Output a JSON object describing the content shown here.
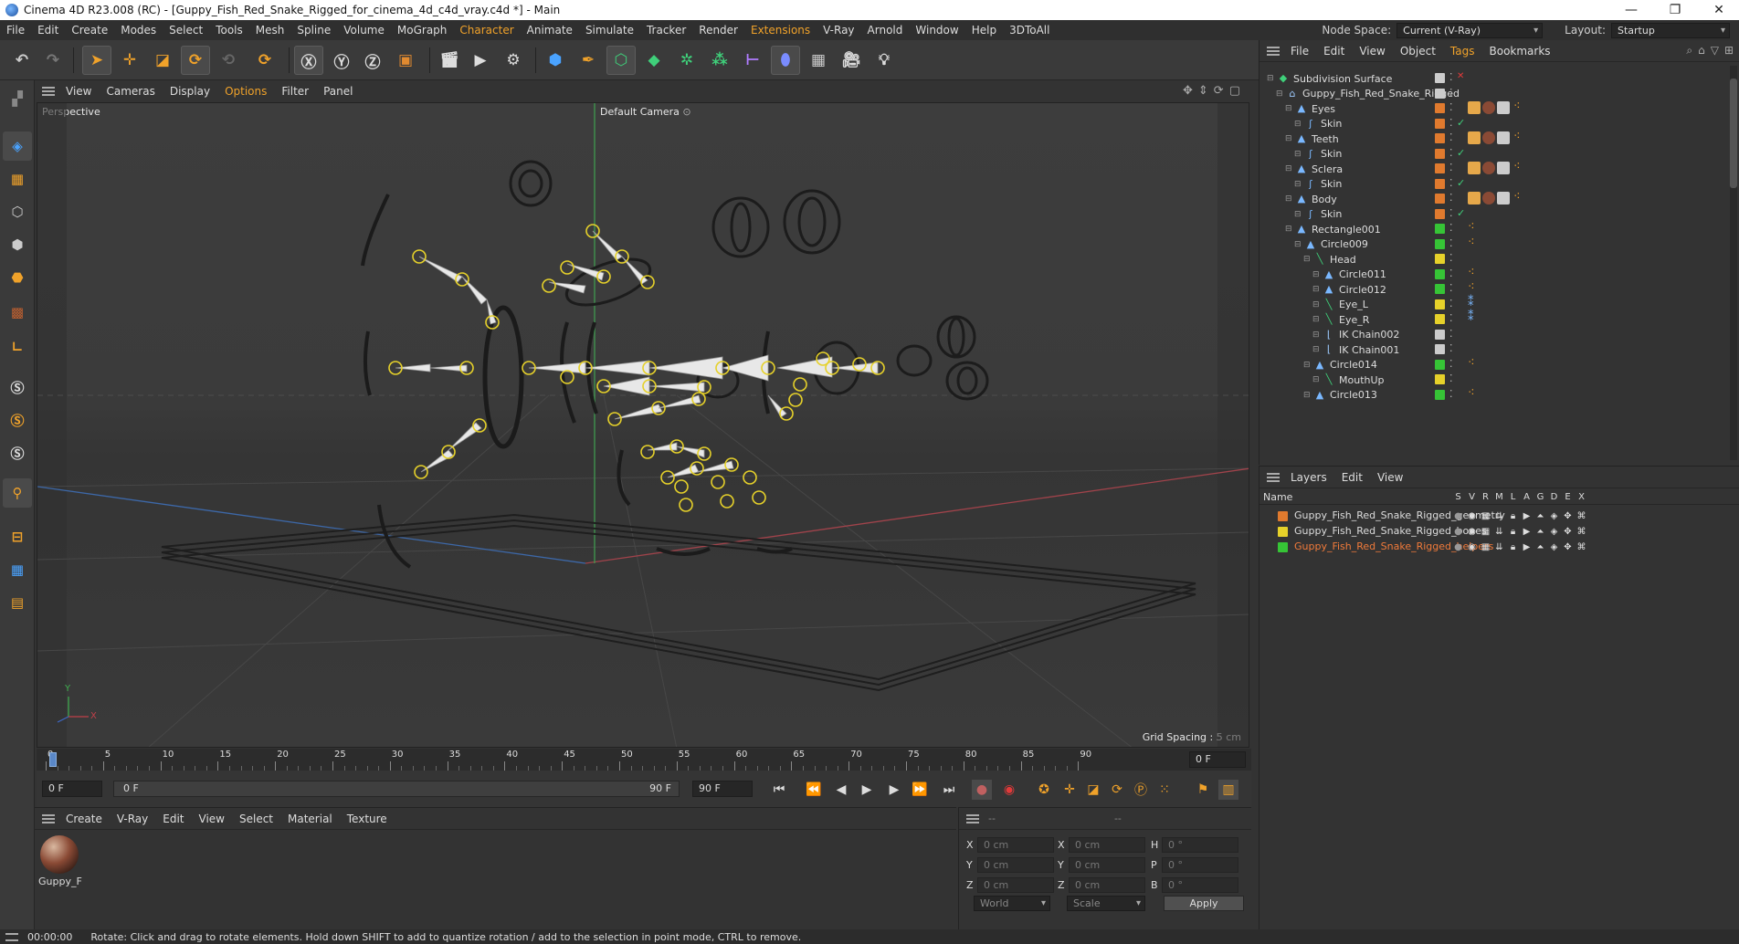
{
  "window": {
    "title": "Cinema 4D R23.008 (RC) - [Guppy_Fish_Red_Snake_Rigged_for_cinema_4d_c4d_vray.c4d *] - Main",
    "min": "—",
    "max": "❐",
    "close": "✕"
  },
  "menu": {
    "items": [
      "File",
      "Edit",
      "Create",
      "Modes",
      "Select",
      "Tools",
      "Mesh",
      "Spline",
      "Volume",
      "MoGraph",
      "Character",
      "Animate",
      "Simulate",
      "Tracker",
      "Render",
      "Extensions",
      "V-Ray",
      "Arnold",
      "Window",
      "Help",
      "3DToAll"
    ],
    "highlighted": [
      "Character",
      "Extensions"
    ],
    "node_space_label": "Node Space:",
    "node_space_value": "Current (V-Ray)",
    "layout_label": "Layout:",
    "layout_value": "Startup"
  },
  "viewport": {
    "menu": [
      "View",
      "Cameras",
      "Display",
      "Options",
      "Filter",
      "Panel"
    ],
    "highlighted": [
      "Options"
    ],
    "label": "Perspective",
    "camera": "Default Camera",
    "grid_spacing": "Grid Spacing : 5 cm",
    "axis_y": "Y",
    "axis_x": "X"
  },
  "timeline": {
    "ticks": [
      "0",
      "5",
      "10",
      "15",
      "20",
      "25",
      "30",
      "35",
      "40",
      "45",
      "50",
      "55",
      "60",
      "65",
      "70",
      "75",
      "80",
      "85",
      "90"
    ],
    "current_frame": "0 F",
    "start_field": "0 F",
    "range_start": "0 F",
    "range_end": "90 F",
    "end_field": "90 F"
  },
  "material_panel": {
    "menu": [
      "Create",
      "V-Ray",
      "Edit",
      "View",
      "Select",
      "Material",
      "Texture"
    ],
    "material_name": "Guppy_F"
  },
  "coords": {
    "header_a": "--",
    "header_b": "--",
    "rows": [
      {
        "l1": "X",
        "v1": "0 cm",
        "l2": "X",
        "v2": "0 cm",
        "l3": "H",
        "v3": "0 °"
      },
      {
        "l1": "Y",
        "v1": "0 cm",
        "l2": "Y",
        "v2": "0 cm",
        "l3": "P",
        "v3": "0 °"
      },
      {
        "l1": "Z",
        "v1": "0 cm",
        "l2": "Z",
        "v2": "0 cm",
        "l3": "B",
        "v3": "0 °"
      }
    ],
    "mode1": "World",
    "mode2": "Scale",
    "apply": "Apply"
  },
  "object_manager": {
    "menu": [
      "File",
      "Edit",
      "View",
      "Object",
      "Tags",
      "Bookmarks"
    ],
    "highlighted": [
      "Tags"
    ],
    "rows": [
      {
        "name": "Subdivision Surface",
        "indent": 0,
        "icon": "subdivision",
        "color": "#cfcfcf"
      },
      {
        "name": "Guppy_Fish_Red_Snake_Rigged",
        "indent": 1,
        "icon": "null",
        "color": "#cfcfcf"
      },
      {
        "name": "Eyes",
        "indent": 2,
        "icon": "joint",
        "color": "#e07a2e"
      },
      {
        "name": "Skin",
        "indent": 3,
        "icon": "skin",
        "color": "#e07a2e"
      },
      {
        "name": "Teeth",
        "indent": 2,
        "icon": "joint",
        "color": "#e07a2e"
      },
      {
        "name": "Skin",
        "indent": 3,
        "icon": "skin",
        "color": "#e07a2e"
      },
      {
        "name": "Sclera",
        "indent": 2,
        "icon": "joint",
        "color": "#e07a2e"
      },
      {
        "name": "Skin",
        "indent": 3,
        "icon": "skin",
        "color": "#e07a2e"
      },
      {
        "name": "Body",
        "indent": 2,
        "icon": "joint",
        "color": "#e07a2e"
      },
      {
        "name": "Skin",
        "indent": 3,
        "icon": "skin",
        "color": "#e07a2e"
      },
      {
        "name": "Rectangle001",
        "indent": 2,
        "icon": "joint",
        "color": "#36c436"
      },
      {
        "name": "Circle009",
        "indent": 3,
        "icon": "joint",
        "color": "#36c436"
      },
      {
        "name": "Head",
        "indent": 4,
        "icon": "bone",
        "color": "#e6d12a"
      },
      {
        "name": "Circle011",
        "indent": 5,
        "icon": "joint",
        "color": "#36c436"
      },
      {
        "name": "Circle012",
        "indent": 5,
        "icon": "joint",
        "color": "#36c436"
      },
      {
        "name": "Eye_L",
        "indent": 5,
        "icon": "bone",
        "color": "#e6d12a"
      },
      {
        "name": "Eye_R",
        "indent": 5,
        "icon": "bone",
        "color": "#e6d12a"
      },
      {
        "name": "IK Chain002",
        "indent": 5,
        "icon": "ik",
        "color": "#cfcfcf"
      },
      {
        "name": "IK Chain001",
        "indent": 5,
        "icon": "ik",
        "color": "#cfcfcf"
      },
      {
        "name": "Circle014",
        "indent": 4,
        "icon": "joint",
        "color": "#36c436"
      },
      {
        "name": "MouthUp",
        "indent": 5,
        "icon": "bone",
        "color": "#e6d12a"
      },
      {
        "name": "Circle013",
        "indent": 4,
        "icon": "joint",
        "color": "#36c436"
      }
    ]
  },
  "layers": {
    "menu": [
      "Layers",
      "Edit",
      "View"
    ],
    "name_header": "Name",
    "cols": [
      "S",
      "V",
      "R",
      "M",
      "L",
      "A",
      "G",
      "D",
      "E",
      "X"
    ],
    "rows": [
      {
        "name": "Guppy_Fish_Red_Snake_Rigged_geometry",
        "color": "#e07a2e",
        "active": false
      },
      {
        "name": "Guppy_Fish_Red_Snake_Rigged_bones",
        "color": "#e6d12a",
        "active": false
      },
      {
        "name": "Guppy_Fish_Red_Snake_Rigged_helpers",
        "color": "#36c436",
        "active": true
      }
    ]
  },
  "status": {
    "time": "00:00:00",
    "message": "Rotate: Click and drag to rotate elements. Hold down SHIFT to add to quantize rotation / add to the selection in point mode, CTRL to remove."
  }
}
